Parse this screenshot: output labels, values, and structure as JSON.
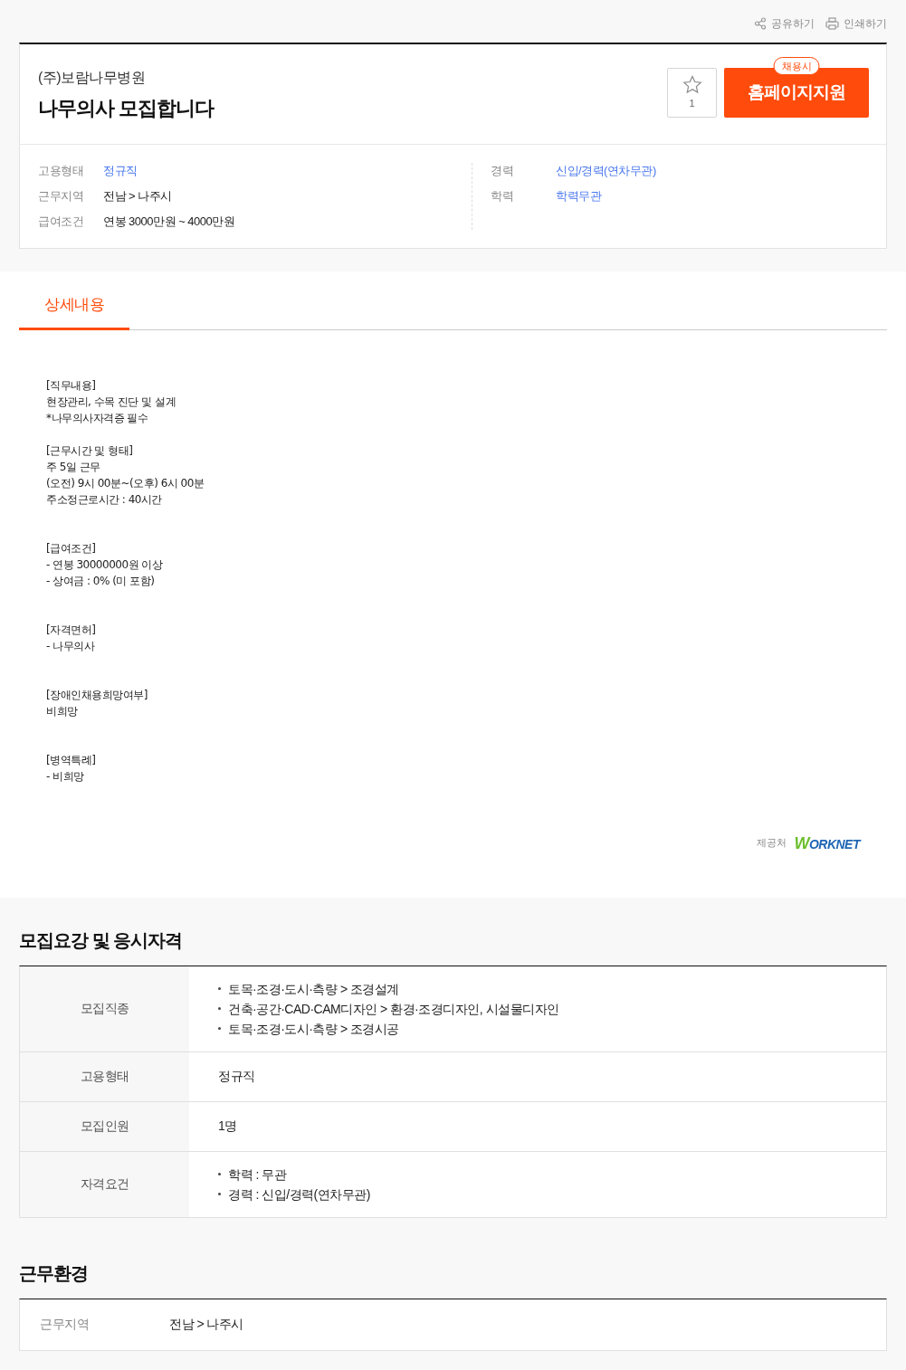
{
  "toolbar": [
    {
      "label": "공유하기",
      "kind": "share"
    },
    {
      "label": "인쇄하기",
      "kind": "print"
    }
  ],
  "header": {
    "company": "(주)보람나무병원",
    "title": "나무의사 모집합니다",
    "scrap_count": "1",
    "apply_badge": "채용시",
    "apply_button": "홈페이지지원"
  },
  "summary": {
    "left_column": [
      {
        "label": "고용형태",
        "value": "정규직",
        "highlight": true
      },
      {
        "label": "근무지역",
        "value": "전남 > 나주시",
        "highlight": false
      },
      {
        "label": "급여조건",
        "value": "연봉 3000만원 ~ 4000만원",
        "highlight": false
      }
    ],
    "right_column": [
      {
        "label": "경력",
        "value": "신입/경력(연차무관)",
        "highlight": true
      },
      {
        "label": "학력",
        "value": "학력무관",
        "highlight": true
      }
    ]
  },
  "tabs": [
    {
      "label": "상세내용",
      "selected": true
    }
  ],
  "description": "[직무내용]\n현장관리, 수목 진단 및 설계\n*나무의사자격증 필수\n\n[근무시간 및 형태]\n주 5일 근무\n(오전) 9시 00분~(오후) 6시 00분\n주소정근로시간 : 40시간\n\n\n[급여조건]\n- 연봉 30000000원 이상\n- 상여금 : 0% (미 포함)\n\n\n[자격면허]\n- 나무의사\n\n\n[장애인채용희망여부]\n비희망\n\n\n[병역특례]\n- 비희망",
  "provider": {
    "label": "제공처",
    "logo_text": "WORKNET"
  },
  "recruitment": {
    "title": "모집요강 및 응시자격",
    "rows": [
      {
        "label": "모집직종",
        "kind": "list",
        "items": [
          "토목·조경·도시·측량 > 조경설계",
          "건축·공간·CAD·CAM디자인 > 환경·조경디자인, 시설물디자인",
          "토목·조경·도시·측량 > 조경시공"
        ]
      },
      {
        "label": "고용형태",
        "kind": "text",
        "value": "정규직"
      },
      {
        "label": "모집인원",
        "kind": "text",
        "value": "1명"
      },
      {
        "label": "자격요건",
        "kind": "list",
        "items": [
          "학력 : 무관",
          "경력 : 신입/경력(연차무관)"
        ]
      }
    ]
  },
  "environment": {
    "title": "근무환경",
    "rows": [
      {
        "label": "근무지역",
        "value": "전남 > 나주시"
      }
    ]
  }
}
